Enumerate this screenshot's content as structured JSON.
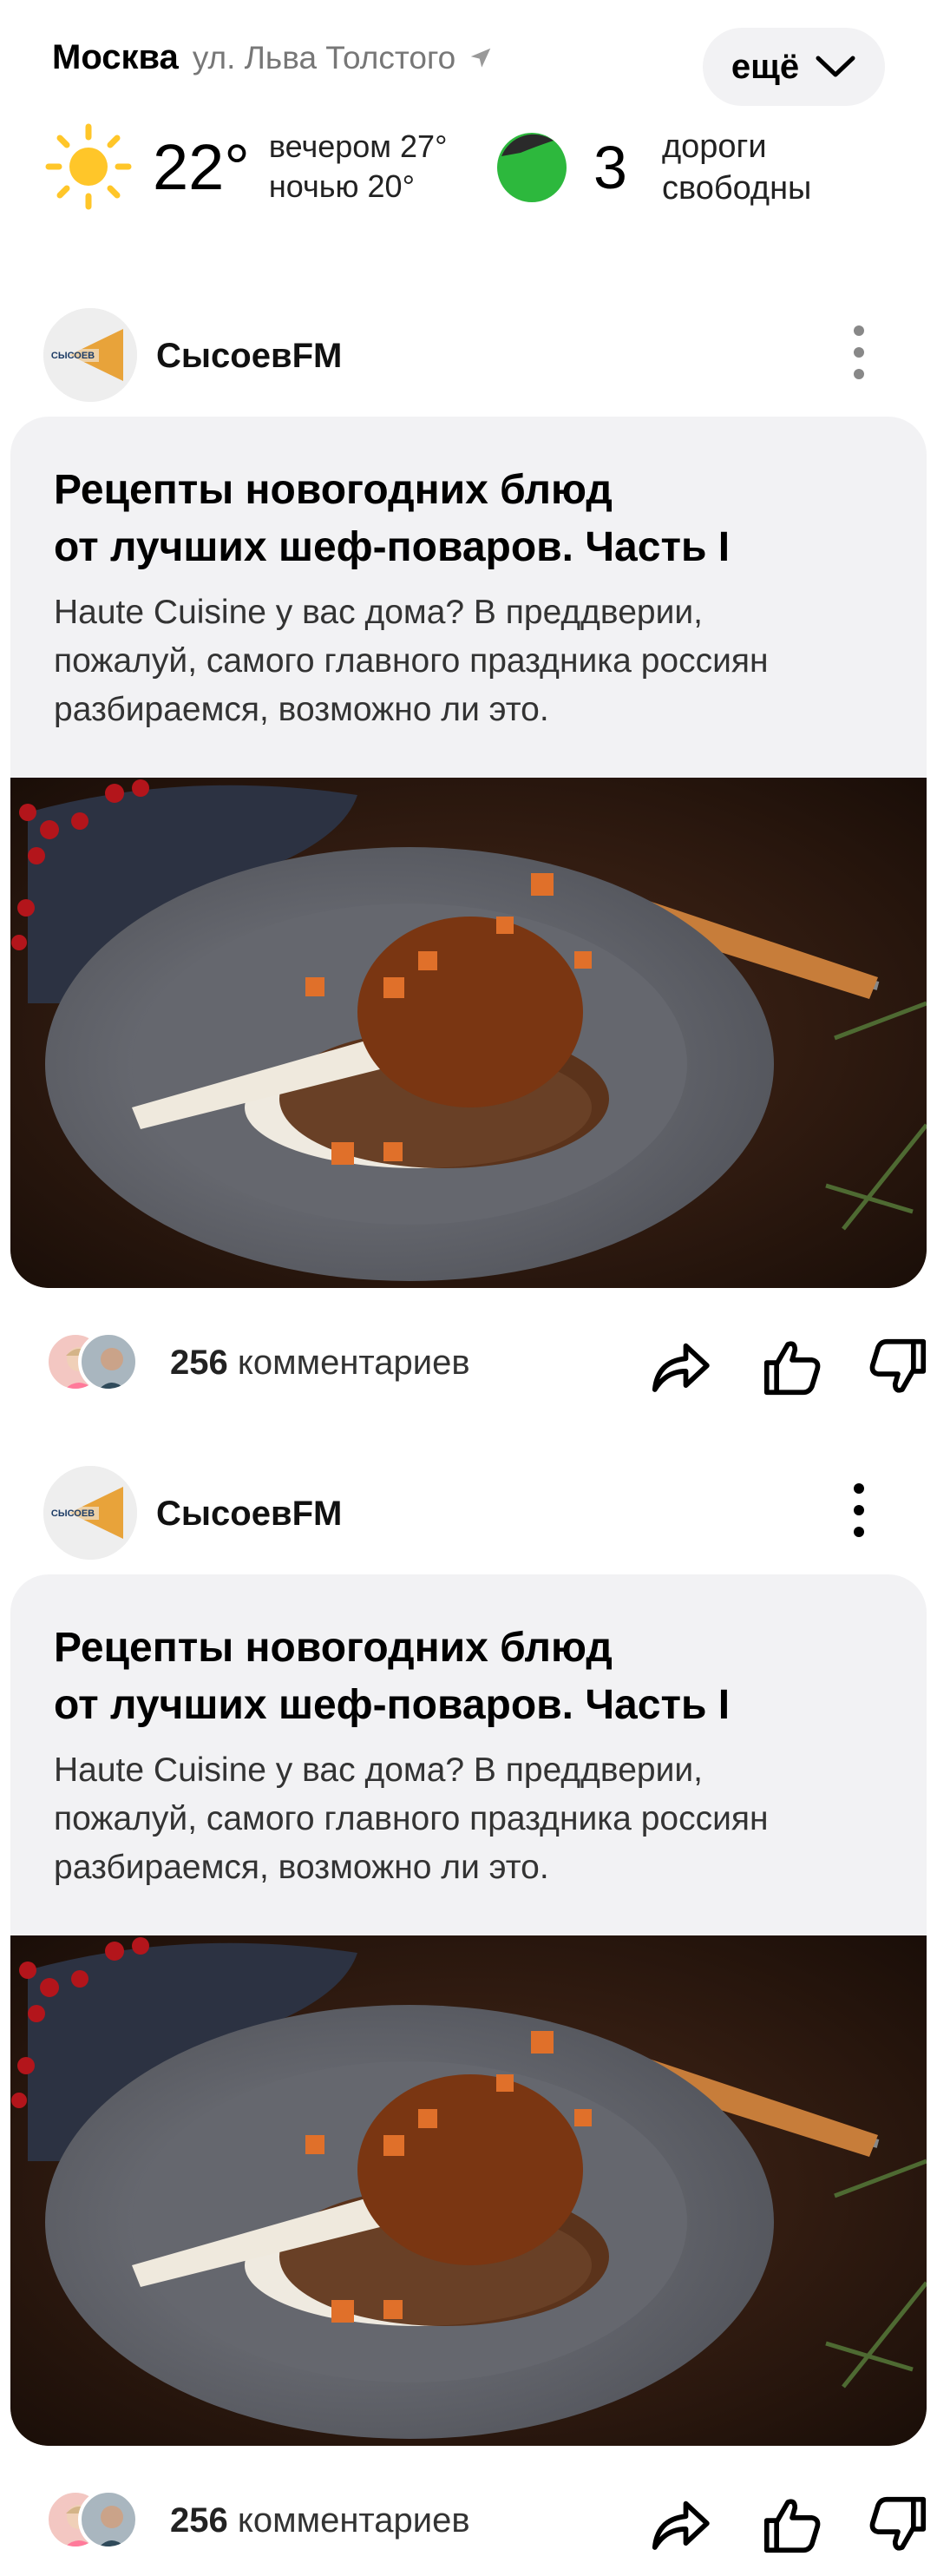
{
  "header": {
    "city": "Москва",
    "street": "ул. Льва Толстого",
    "more_label": "ещё",
    "weather": {
      "temp": "22°",
      "evening": "вечером 27°",
      "night": "ночью 20°",
      "icon": "sun-icon"
    },
    "traffic": {
      "score": "3",
      "line1": "дороги",
      "line2": "свободны",
      "color": "#2db83d"
    }
  },
  "posts": [
    {
      "author": "СысоевFM",
      "logo_text": "сысоев",
      "title_line1": "Рецепты новогодних блюд",
      "title_line2": "от лучших шеф-поваров. Часть I",
      "desc_line1": "Haute Cuisine у вас дома? В преддверии,",
      "desc_line2": "пожалуй, самого главного праздника россиян",
      "desc_line3": "разбираемся, возможно ли это.",
      "comments_count": "256",
      "comments_word": "комментариев"
    },
    {
      "author": "СысоевFM",
      "logo_text": "сысоев",
      "title_line1": "Рецепты новогодних блюд",
      "title_line2": "от лучших шеф-поваров. Часть I",
      "desc_line1": "Haute Cuisine у вас дома? В преддверии,",
      "desc_line2": "пожалуй, самого главного праздника россиян",
      "desc_line3": "разбираемся, возможно ли это.",
      "comments_count": "256",
      "comments_word": "комментариев"
    }
  ],
  "colors": {
    "card_bg": "#f2f2f4",
    "logo_orange": "#e8a33a",
    "sun": "#ffc629"
  }
}
